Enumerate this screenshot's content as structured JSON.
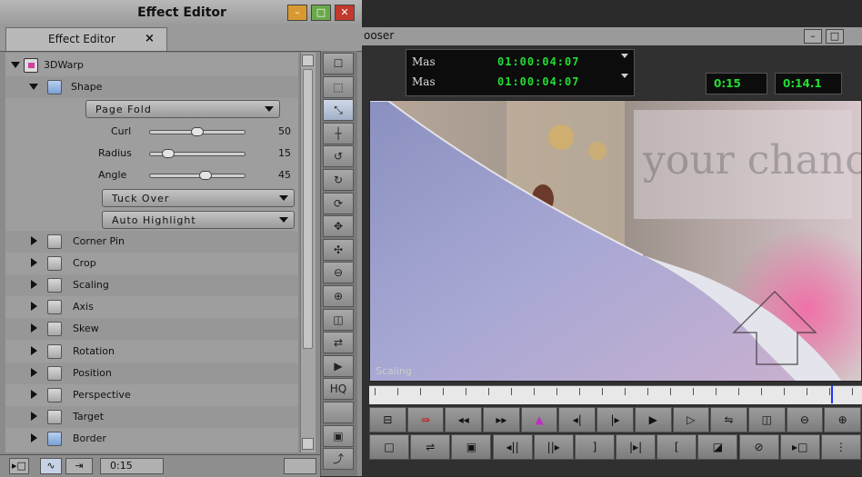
{
  "effect_editor": {
    "window_title": "Effect Editor",
    "tab_label": "Effect Editor",
    "tab_close": "×",
    "root_effect": "3DWarp",
    "group_shape": "Shape",
    "shape_select": "Page Fold",
    "sliders": [
      {
        "label": "Curl",
        "value": "50",
        "fraction": 0.5
      },
      {
        "label": "Radius",
        "value": "15",
        "fraction": 0.15
      },
      {
        "label": "Angle",
        "value": "45",
        "fraction": 0.6
      }
    ],
    "fold_select": "Tuck Over",
    "highlight_select": "Auto Highlight",
    "groups": [
      "Corner Pin",
      "Crop",
      "Scaling",
      "Axis",
      "Skew",
      "Rotation",
      "Position",
      "Perspective",
      "Target",
      "Border"
    ],
    "bottom_time": "0:15"
  },
  "tools": [
    "☐",
    "⬚",
    "⤡",
    "┼",
    "↺",
    "↻",
    "⟳",
    "✥",
    "✣",
    "⊖",
    "⊕",
    "◫",
    "⇄",
    "▶",
    "HQ",
    "",
    "▣",
    "⤴"
  ],
  "composer": {
    "title": "ooser",
    "tc_rows": [
      {
        "label": "Mas",
        "value": "01:00:04:07"
      },
      {
        "label": "Mas",
        "value": "01:00:04:07"
      }
    ],
    "tc_box1": "0:15",
    "tc_box2": "0:14.1",
    "viewer_label": "Scaling",
    "overlay_text": "your chance .",
    "controls_row1": [
      "⊟",
      "⇛",
      "◂◂",
      "▸▸",
      "▲",
      "◂|",
      "|▸",
      "▶",
      "▷",
      "⇋",
      "◫",
      "⊖",
      "⊕"
    ],
    "controls_row2": [
      "□",
      "⇌",
      "▣",
      "◂||",
      "||▸",
      "]",
      "|▸|",
      "[",
      "◪",
      "⊘",
      "▸□",
      "⋮"
    ]
  },
  "colors": {
    "accent_green": "#22dd33",
    "playhead": "#2233ff"
  }
}
